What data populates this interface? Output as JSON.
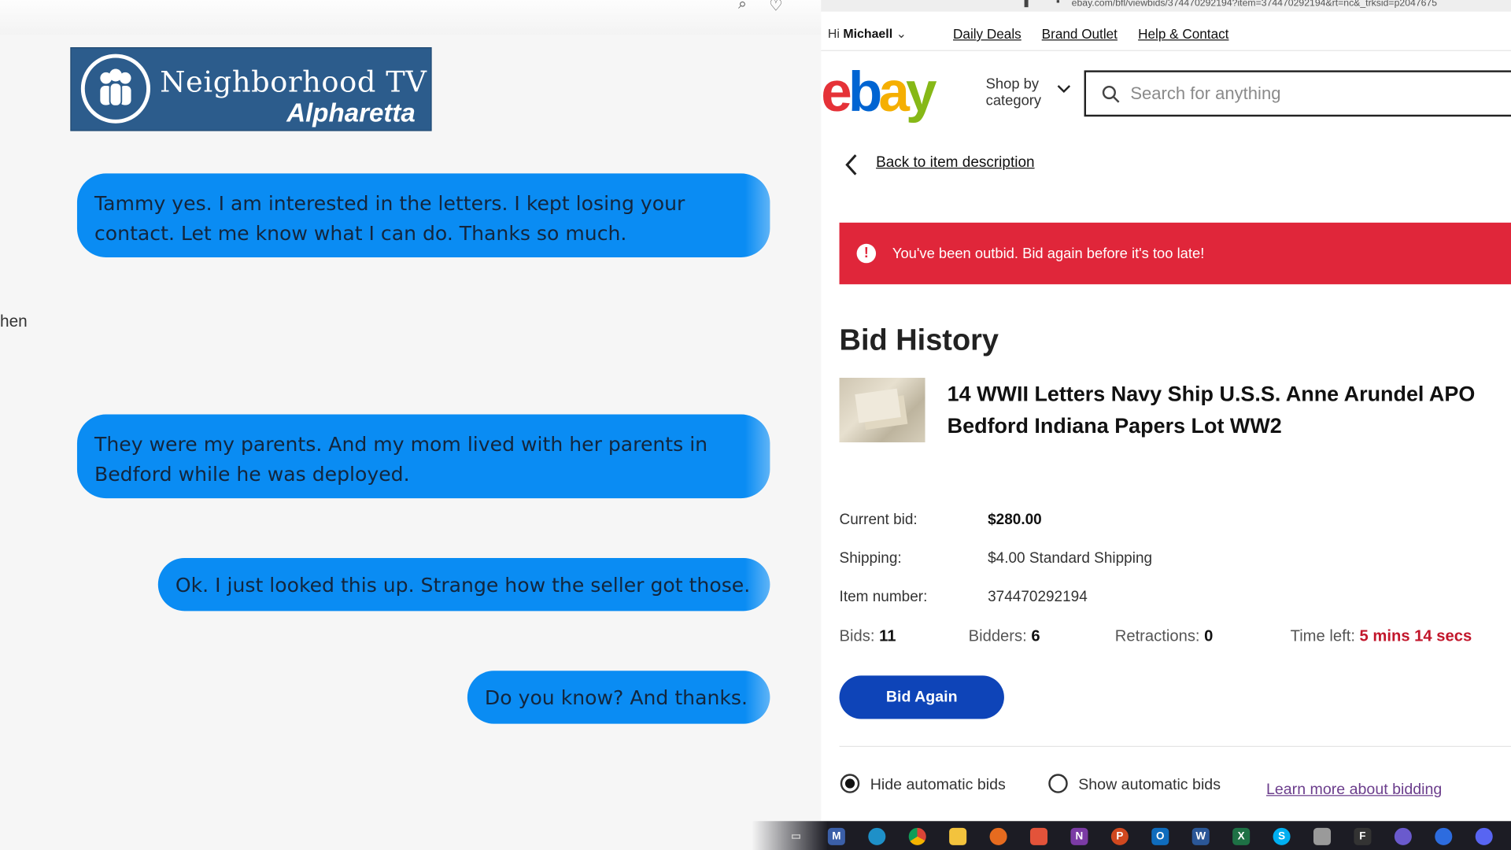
{
  "left": {
    "logo": {
      "title": "Neighborhood TV",
      "subtitle": "Alpharetta"
    },
    "clipped_text": "hen",
    "messages": [
      "Tammy yes. I am interested in the letters. I kept losing your contact. Let me know what I can do. Thanks so much.",
      "They were my parents. And my mom lived with her parents in Bedford while he was deployed.",
      "Ok. I just looked this up. Strange how the seller got those.",
      "Do you know? And thanks."
    ],
    "bubble_color": "#0a8cf3"
  },
  "browser": {
    "url": "ebay.com/bfl/viewbids/374470292194?item=374470292194&rt=nc&_trksid=p2047675"
  },
  "ebay": {
    "greeting_prefix": "Hi",
    "user": "Michaell",
    "top_links": [
      "Daily Deals",
      "Brand Outlet",
      "Help & Contact"
    ],
    "logo_letters": [
      {
        "char": "e",
        "color": "#e53238"
      },
      {
        "char": "b",
        "color": "#0064d2"
      },
      {
        "char": "a",
        "color": "#f5af02"
      },
      {
        "char": "y",
        "color": "#86b817"
      }
    ],
    "shop_by": [
      "Shop by",
      "category"
    ],
    "search_placeholder": "Search for anything",
    "back_label": "Back to item description",
    "alert": {
      "icon": "!",
      "text": "You've been outbid. Bid again before it's too late!",
      "color": "#e0263a"
    },
    "heading": "Bid History",
    "item_title": "14 WWII Letters Navy Ship U.S.S. Anne Arundel APO Bedford Indiana Papers Lot WW2",
    "details": [
      {
        "label": "Current bid:",
        "value": "$280.00"
      },
      {
        "label": "Shipping:",
        "value": "$4.00 Standard Shipping"
      },
      {
        "label": "Item number:",
        "value": "374470292194"
      }
    ],
    "stats": {
      "bids_label": "Bids:",
      "bids": "11",
      "bidders_label": "Bidders:",
      "bidders": "6",
      "retractions_label": "Retractions:",
      "retractions": "0",
      "time_label": "Time left:",
      "time": "5 mins 14 secs"
    },
    "bid_again_label": "Bid Again",
    "radios": [
      {
        "label": "Hide automatic bids",
        "selected": true
      },
      {
        "label": "Show automatic bids",
        "selected": false
      }
    ],
    "learn_more": "Learn more about bidding"
  },
  "taskbar": {
    "icons": [
      "task-view-icon",
      "app-m-icon",
      "edge-icon",
      "chrome-icon",
      "file-explorer-icon",
      "firefox-icon",
      "brave-icon",
      "onenote-icon",
      "powerpoint-icon",
      "outlook-icon",
      "word-icon",
      "excel-icon",
      "skype-icon",
      "app-icon",
      "app-f-icon",
      "app-feather-icon",
      "app-blue-icon",
      "discord-icon"
    ]
  }
}
